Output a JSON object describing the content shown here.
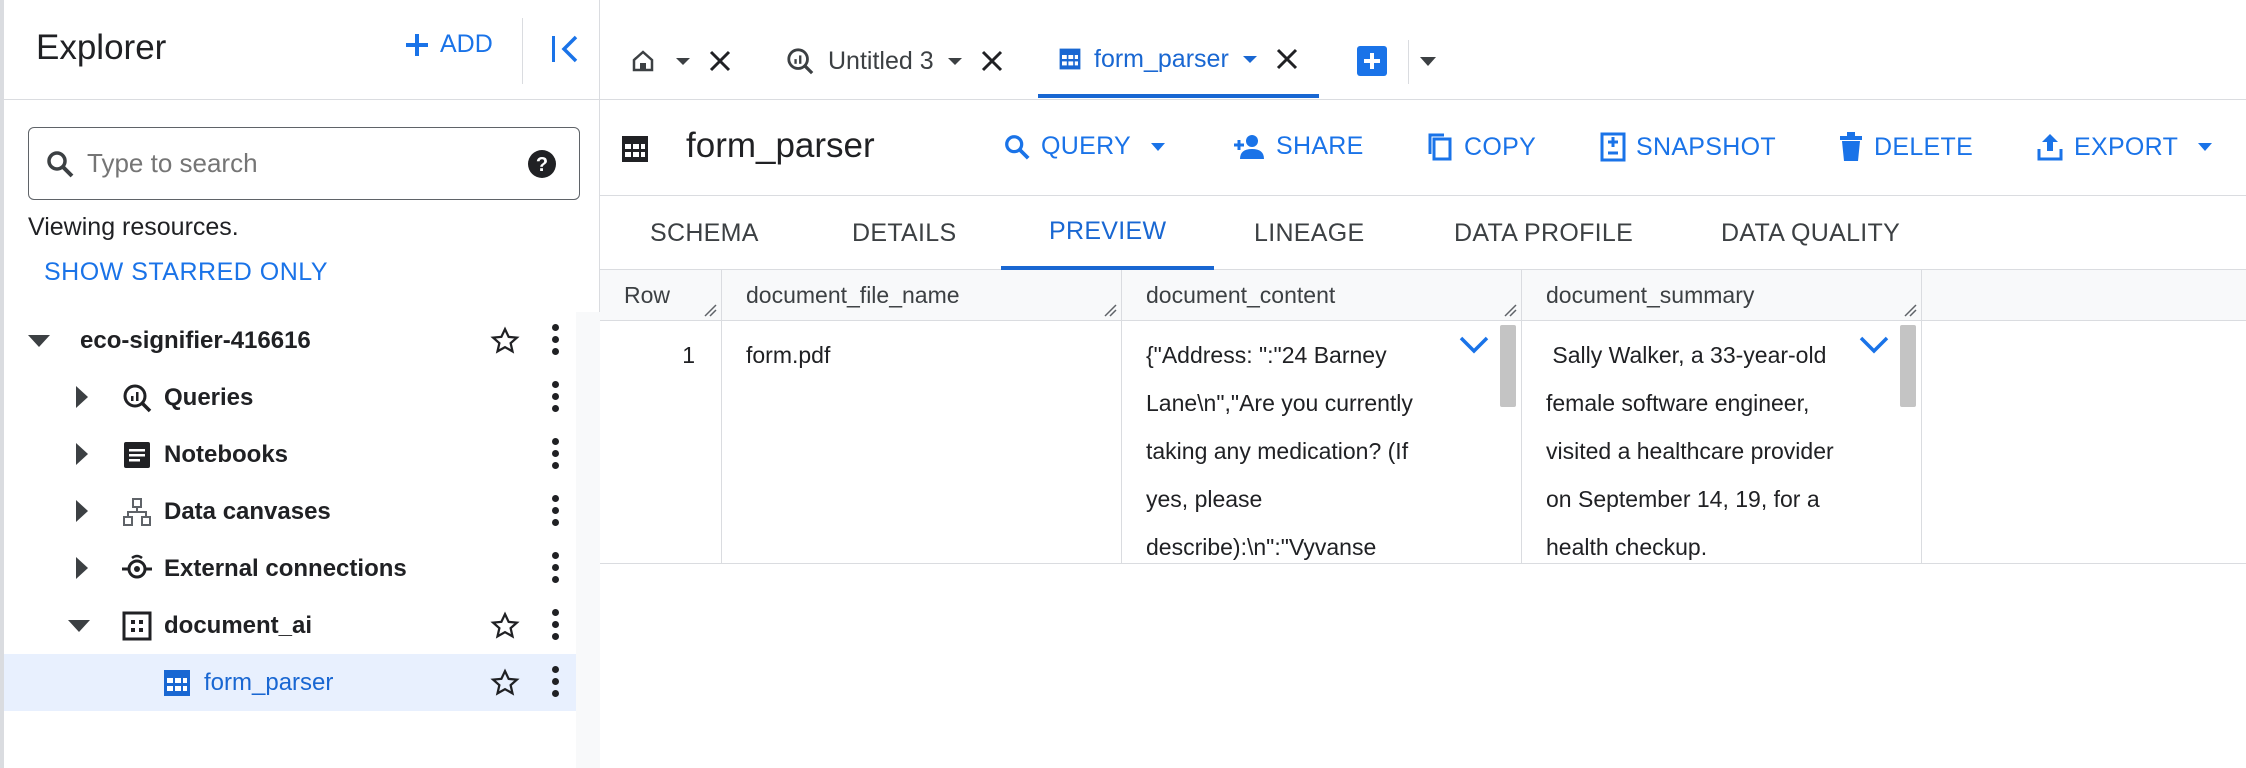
{
  "explorer": {
    "title": "Explorer",
    "add_label": "ADD",
    "search_placeholder": "Type to search",
    "viewing_text": "Viewing resources.",
    "show_starred": "SHOW STARRED ONLY",
    "tree": {
      "project": "eco-signifier-416616",
      "items": [
        {
          "label": "Queries",
          "icon": "queries-icon"
        },
        {
          "label": "Notebooks",
          "icon": "notebook-icon"
        },
        {
          "label": "Data canvases",
          "icon": "data-canvas-icon"
        },
        {
          "label": "External connections",
          "icon": "external-connection-icon"
        }
      ],
      "dataset": "document_ai",
      "table": "form_parser"
    }
  },
  "tabs": {
    "home_icon": "home-icon",
    "items": [
      {
        "label": "Untitled 3",
        "icon": "query-icon"
      },
      {
        "label": "form_parser",
        "icon": "table-icon",
        "active": true
      }
    ]
  },
  "toolbar": {
    "title": "form_parser",
    "buttons": {
      "query": "QUERY",
      "share": "SHARE",
      "copy": "COPY",
      "snapshot": "SNAPSHOT",
      "delete": "DELETE",
      "export": "EXPORT"
    }
  },
  "subtabs": {
    "schema": "SCHEMA",
    "details": "DETAILS",
    "preview": "PREVIEW",
    "lineage": "LINEAGE",
    "data_profile": "DATA PROFILE",
    "data_quality": "DATA QUALITY",
    "active": "PREVIEW"
  },
  "grid": {
    "columns": {
      "row": "Row",
      "file_name": "document_file_name",
      "content": "document_content",
      "summary": "document_summary"
    },
    "rows": [
      {
        "row": "1",
        "file_name": "form.pdf",
        "content": "{\"Address: \":\"24 Barney Lane\\n\",\"Are you currently taking any medication? (If yes, please describe):\\n\":\"Vyvanse",
        "summary": " Sally Walker, a 33-year-old female software engineer, visited a healthcare provider on September 14, 19, for a health checkup."
      }
    ]
  },
  "colors": {
    "accent": "#1a73e8",
    "accent_dark": "#1967d2",
    "selected_bg": "#e8f0fe",
    "border": "#dadce0"
  }
}
